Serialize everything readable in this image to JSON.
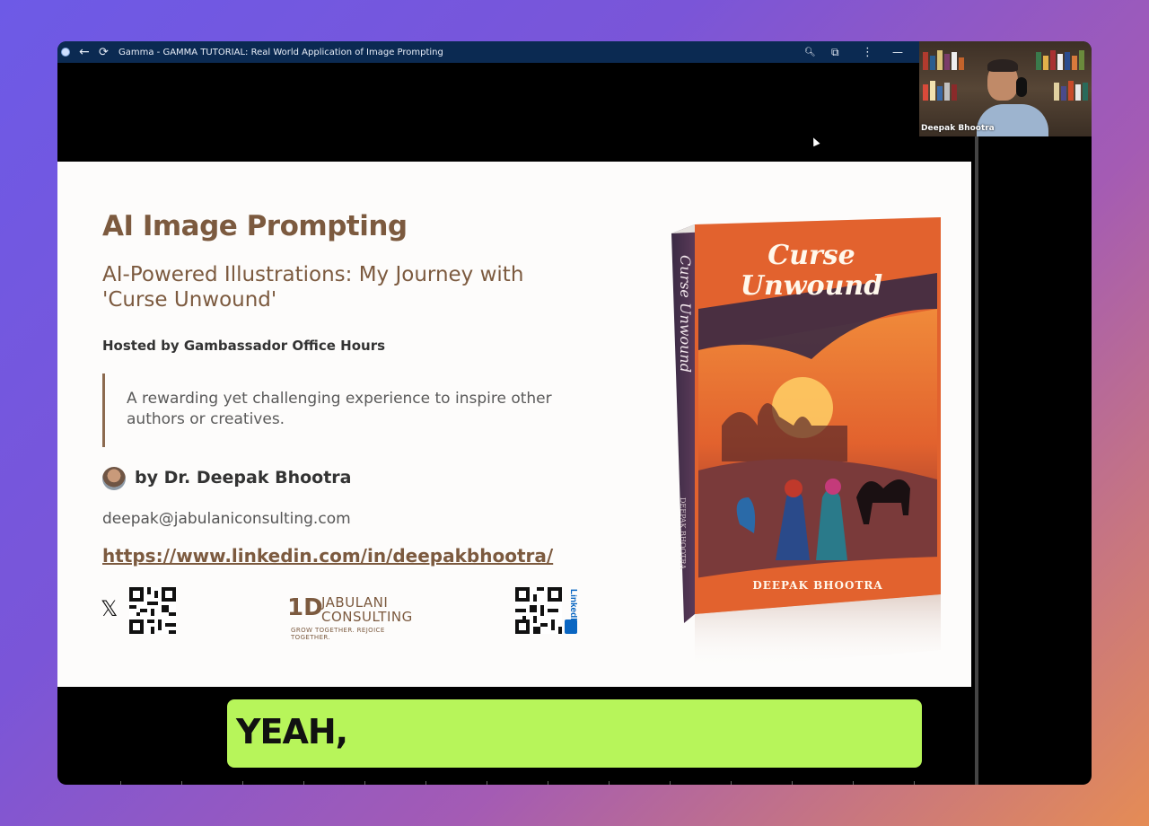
{
  "browser": {
    "title": "Gamma - GAMMA TUTORIAL: Real World Application of Image Prompting",
    "icons": [
      "app-icon",
      "back-arrow-icon",
      "reload-icon",
      "zoom-icon",
      "extension-icon",
      "kebab-menu-icon",
      "minimize-icon"
    ]
  },
  "video": {
    "participant_name": "Deepak Bhootra"
  },
  "slide": {
    "title": "AI Image Prompting",
    "subtitle": "AI-Powered Illustrations: My Journey with 'Curse Unwound'",
    "hosted": "Hosted by Gambassador Office Hours",
    "quote": "A rewarding yet challenging experience to inspire other authors or creatives.",
    "byline": "by Dr. Deepak Bhootra",
    "email": "deepak@jabulaniconsulting.com",
    "linkedin": "https://www.linkedin.com/in/deepakbhootra/",
    "x_icon": "𝕏",
    "logo": {
      "mark": "1D",
      "name_line1": "JABULANI",
      "name_line2": "CONSULTING",
      "tagline": "GROW TOGETHER. REJOICE TOGETHER."
    },
    "linkedin_badge": "LinkedIn",
    "book": {
      "title_line1": "Curse",
      "title_line2": "Unwound",
      "spine_title": "Curse Unwound",
      "author": "DEEPAK BHOOTRA",
      "spine_author": "DEEPAK BHOOTRA"
    }
  },
  "caption": {
    "text": "YEAH,"
  },
  "colors": {
    "accent_brown": "#7c5a3f",
    "caption_bg": "#b7f55a",
    "titlebar_bg": "#0b2a52",
    "book_orange": "#e2622e"
  }
}
